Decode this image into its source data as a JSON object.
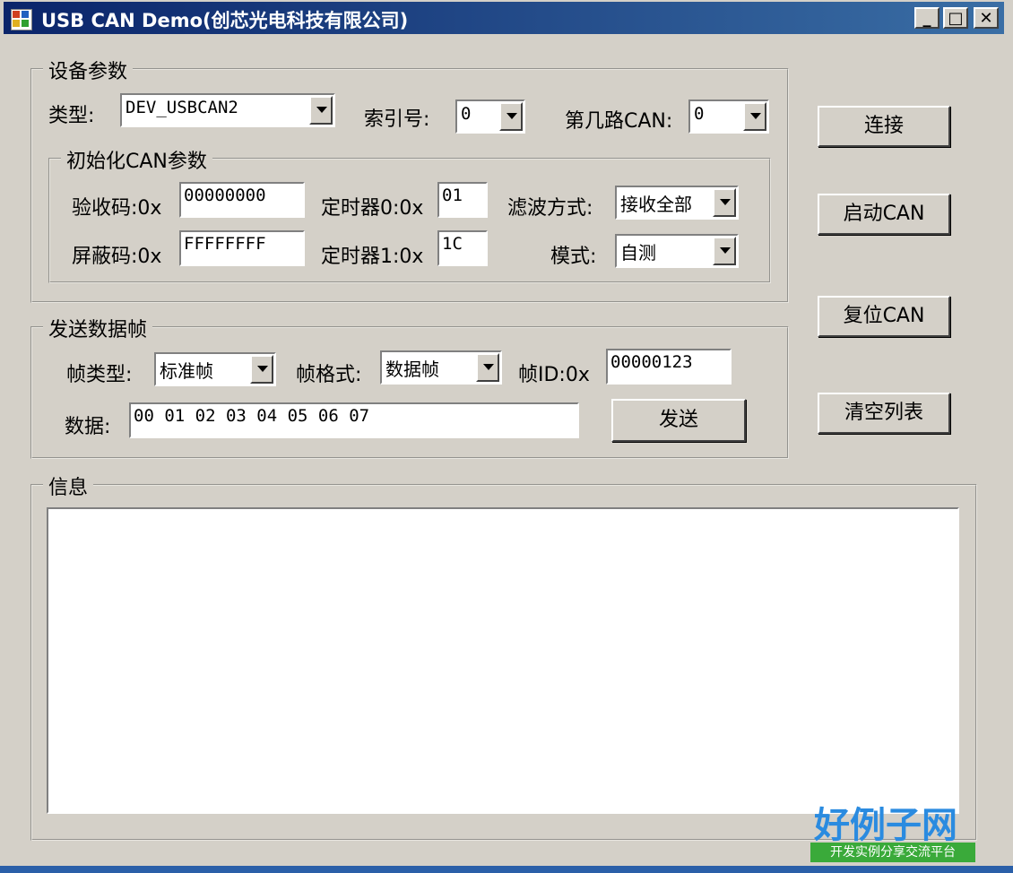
{
  "window": {
    "title": "USB CAN Demo(创芯光电科技有限公司)",
    "minimize": "_",
    "maximize": "□",
    "close": "✕"
  },
  "device": {
    "legend": "设备参数",
    "type_label": "类型:",
    "type_value": "DEV_USBCAN2",
    "index_label": "索引号:",
    "index_value": "0",
    "channel_label": "第几路CAN:",
    "channel_value": "0"
  },
  "init": {
    "legend": "初始化CAN参数",
    "acc_code_label": "验收码:0x",
    "acc_code_value": "00000000",
    "mask_label": "屏蔽码:0x",
    "mask_value": "FFFFFFFF",
    "timer0_label": "定时器0:0x",
    "timer0_value": "01",
    "timer1_label": "定时器1:0x",
    "timer1_value": "1C",
    "filter_label": "滤波方式:",
    "filter_value": "接收全部",
    "mode_label": "模式:",
    "mode_value": "自测"
  },
  "send": {
    "legend": "发送数据帧",
    "frame_type_label": "帧类型:",
    "frame_type_value": "标准帧",
    "frame_format_label": "帧格式:",
    "frame_format_value": "数据帧",
    "frame_id_label": "帧ID:0x",
    "frame_id_value": "00000123",
    "data_label": "数据:",
    "data_value": "00 01 02 03 04 05 06 07",
    "send_button": "发送"
  },
  "buttons": {
    "connect": "连接",
    "start_can": "启动CAN",
    "reset_can": "复位CAN",
    "clear_list": "清空列表"
  },
  "info": {
    "legend": "信息"
  },
  "watermark": {
    "title": "好例子网",
    "subtitle": "开发实例分享交流平台"
  }
}
